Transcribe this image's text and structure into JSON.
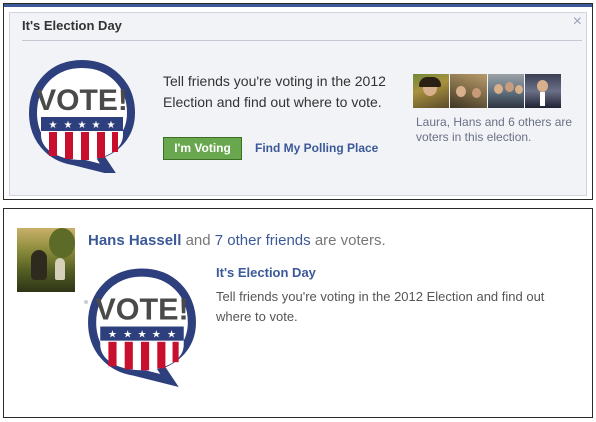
{
  "panel1": {
    "title": "It's Election Day",
    "close_glyph": "×",
    "badge_text": "VOTE!",
    "message": "Tell friends you're voting in the 2012 Election and find out where to vote.",
    "primary_button": "I'm Voting",
    "secondary_link": "Find My Polling Place",
    "friends_caption": "Laura, Hans and 6 others are voters in this election.",
    "photo_count": 4
  },
  "panel2": {
    "friend_name": "Hans Hassell",
    "joiner": "and",
    "others_link": "7 other friends",
    "suffix": "are voters.",
    "title": "It's Election Day",
    "badge_text": "VOTE!",
    "message": "Tell friends you're voting in the 2012 Election and find out where to vote."
  },
  "colors": {
    "facebook_blue": "#3b5998",
    "button_green": "#69a74e",
    "badge_navy": "#2d3f7c",
    "badge_red": "#c8102e"
  },
  "icons": {
    "close": "close-icon",
    "badge": "vote-badge-icon"
  }
}
